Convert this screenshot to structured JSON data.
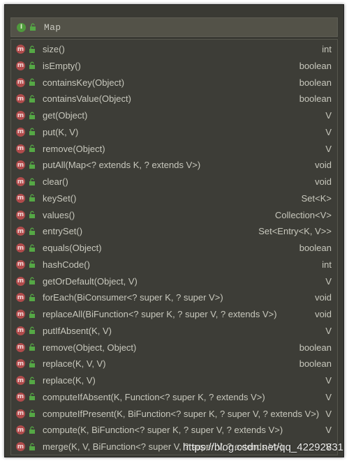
{
  "header": {
    "title": "Map",
    "icon": "interface-icon",
    "badge_letter": "I"
  },
  "badge_letter": "m",
  "methods": [
    {
      "name": "size()",
      "type": "int"
    },
    {
      "name": "isEmpty()",
      "type": "boolean"
    },
    {
      "name": "containsKey(Object)",
      "type": "boolean"
    },
    {
      "name": "containsValue(Object)",
      "type": "boolean"
    },
    {
      "name": "get(Object)",
      "type": "V"
    },
    {
      "name": "put(K, V)",
      "type": "V"
    },
    {
      "name": "remove(Object)",
      "type": "V"
    },
    {
      "name": "putAll(Map<? extends K, ? extends V>)",
      "type": "void"
    },
    {
      "name": "clear()",
      "type": "void"
    },
    {
      "name": "keySet()",
      "type": "Set<K>"
    },
    {
      "name": "values()",
      "type": "Collection<V>"
    },
    {
      "name": "entrySet()",
      "type": "Set<Entry<K, V>>"
    },
    {
      "name": "equals(Object)",
      "type": "boolean"
    },
    {
      "name": "hashCode()",
      "type": "int"
    },
    {
      "name": "getOrDefault(Object, V)",
      "type": "V"
    },
    {
      "name": "forEach(BiConsumer<? super K, ? super V>)",
      "type": "void"
    },
    {
      "name": "replaceAll(BiFunction<? super K, ? super V, ? extends V>)",
      "type": "void"
    },
    {
      "name": "putIfAbsent(K, V)",
      "type": "V"
    },
    {
      "name": "remove(Object, Object)",
      "type": "boolean"
    },
    {
      "name": "replace(K, V, V)",
      "type": "boolean"
    },
    {
      "name": "replace(K, V)",
      "type": "V"
    },
    {
      "name": "computeIfAbsent(K, Function<? super K, ? extends V>)",
      "type": "V"
    },
    {
      "name": "computeIfPresent(K, BiFunction<? super K, ? super V, ? extends V>)",
      "type": "V"
    },
    {
      "name": "compute(K, BiFunction<? super K, ? super V, ? extends V>)",
      "type": "V"
    },
    {
      "name": "merge(K, V, BiFunction<? super V, ? super V, ? extends V>)",
      "type": "V"
    }
  ],
  "watermark": "https://blog.csdn.net/qq_42292831",
  "colors": {
    "background": "#3a3a34",
    "text": "#c8c8bd",
    "interface_badge": "#4f9a3c",
    "method_badge": "#b04b4b",
    "lock_icon": "#55a845"
  }
}
